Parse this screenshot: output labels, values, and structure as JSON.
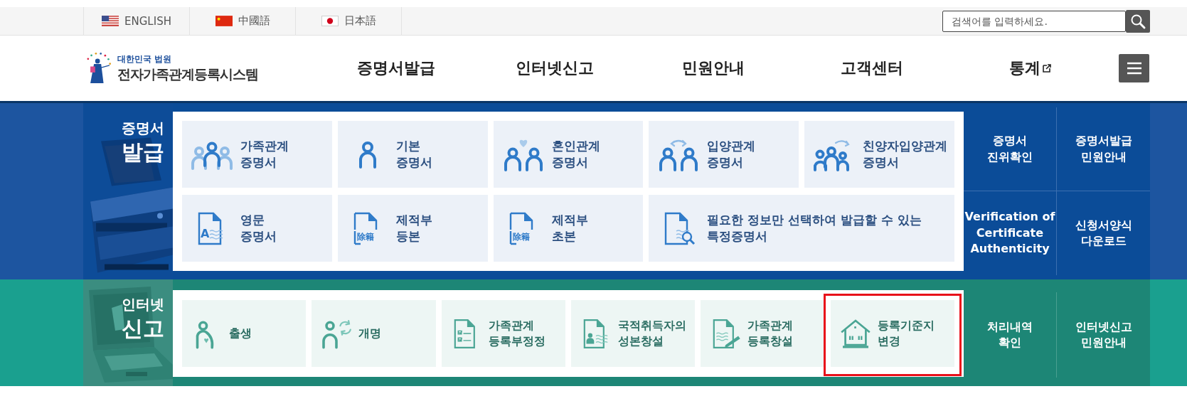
{
  "top_bar": {
    "languages": [
      {
        "label": "ENGLISH"
      },
      {
        "label": "中國語"
      },
      {
        "label": "日本語"
      }
    ],
    "search": {
      "placeholder": "검색어를 입력하세요."
    }
  },
  "header": {
    "logo": {
      "subtitle": "대한민국 법원",
      "title": "전자가족관계등록시스템"
    },
    "nav": [
      {
        "label": "증명서발급",
        "external": false
      },
      {
        "label": "인터넷신고",
        "external": false
      },
      {
        "label": "민원안내",
        "external": false
      },
      {
        "label": "고객센터",
        "external": false
      },
      {
        "label": "통계",
        "external": true
      }
    ]
  },
  "sections": [
    {
      "kind": "certificate",
      "title_top": "증명서",
      "title_bottom": "발급",
      "items": [
        {
          "label": "가족관계\n증명서",
          "wide": false,
          "highlighted": false
        },
        {
          "label": "기본\n증명서",
          "wide": false,
          "highlighted": false
        },
        {
          "label": "혼인관계\n증명서",
          "wide": false,
          "highlighted": false
        },
        {
          "label": "입양관계\n증명서",
          "wide": false,
          "highlighted": false
        },
        {
          "label": "친양자입양관계\n증명서",
          "wide": false,
          "highlighted": false
        },
        {
          "label": "영문\n증명서",
          "icon_text": "A",
          "wide": false,
          "highlighted": false
        },
        {
          "label": "제적부\n등본",
          "icon_text": "除籍",
          "wide": false,
          "highlighted": false
        },
        {
          "label": "제적부\n초본",
          "icon_text": "除籍",
          "wide": false,
          "highlighted": false
        },
        {
          "label": "필요한 정보만 선택하여 발급할 수 있는\n특정증명서",
          "wide": true,
          "highlighted": false
        }
      ],
      "links": [
        "증명서\n진위확인",
        "증명서발급\n민원안내",
        "Verification of\nCertificate\nAuthenticity",
        "신청서양식\n다운로드"
      ]
    },
    {
      "kind": "report",
      "title_top": "인터넷",
      "title_bottom": "신고",
      "items": [
        {
          "label": "출생",
          "wide": false,
          "highlighted": false
        },
        {
          "label": "개명",
          "wide": false,
          "highlighted": false
        },
        {
          "label": "가족관계\n등록부정정",
          "wide": false,
          "highlighted": false
        },
        {
          "label": "국적취득자의\n성본창설",
          "wide": false,
          "highlighted": false
        },
        {
          "label": "가족관계\n등록창설",
          "wide": false,
          "highlighted": false
        },
        {
          "label": "등록기준지\n변경",
          "wide": false,
          "highlighted": true
        }
      ],
      "links": [
        "처리내역\n확인",
        "인터넷신고\n민원안내"
      ]
    }
  ]
}
